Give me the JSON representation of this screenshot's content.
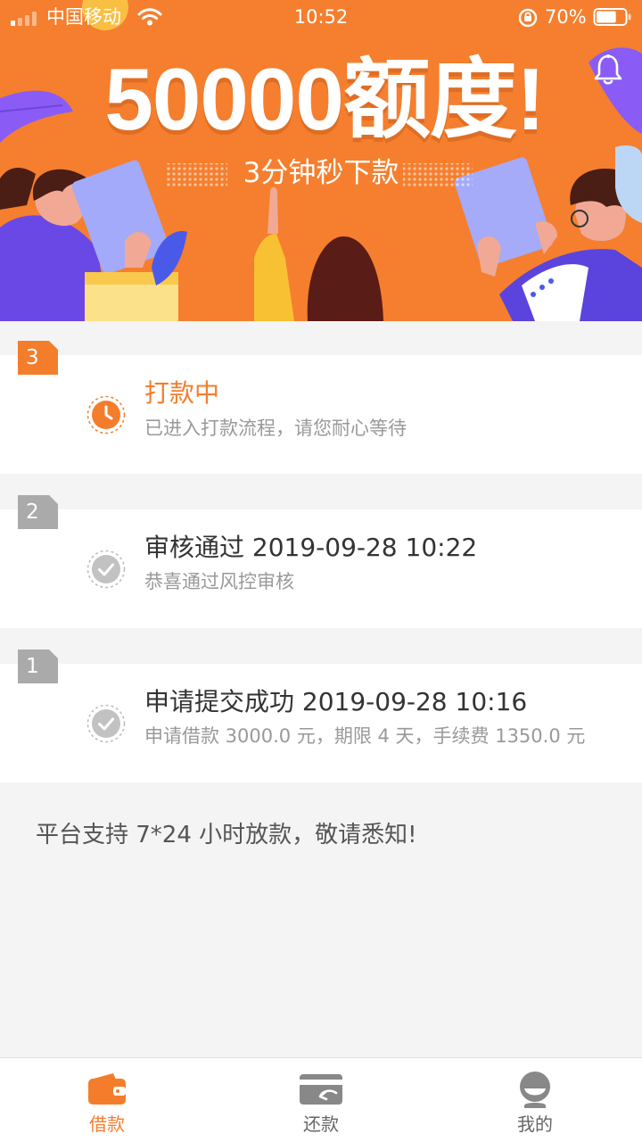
{
  "status_bar": {
    "carrier": "中国移动",
    "time": "10:52",
    "battery_percent": "70%",
    "battery_level": 0.7
  },
  "banner": {
    "headline": "50000额度!",
    "subtitle": "3分钟秒下款",
    "background_color": "#f57f2e",
    "bell_icon": "bell-icon"
  },
  "steps": [
    {
      "number": "3",
      "title": "打款中",
      "description": "已进入打款流程，请您耐心等待",
      "icon": "clock-icon",
      "state": "active"
    },
    {
      "number": "2",
      "title": "审核通过 2019-09-28 10:22",
      "description": "恭喜通过风控审核",
      "icon": "check-icon",
      "state": "done"
    },
    {
      "number": "1",
      "title": "申请提交成功 2019-09-28 10:16",
      "description": "申请借款 3000.0 元，期限 4 天，手续费 1350.0 元",
      "icon": "check-icon",
      "state": "done"
    }
  ],
  "notice": "平台支持 7*24 小时放款，敬请悉知!",
  "tabs": [
    {
      "label": "借款",
      "icon": "wallet-icon",
      "active": true
    },
    {
      "label": "还款",
      "icon": "repay-card-icon",
      "active": false
    },
    {
      "label": "我的",
      "icon": "user-icon",
      "active": false
    }
  ],
  "colors": {
    "accent": "#f47d2c",
    "done_gray": "#aaaaaa",
    "page_background": "#f4f4f4"
  }
}
